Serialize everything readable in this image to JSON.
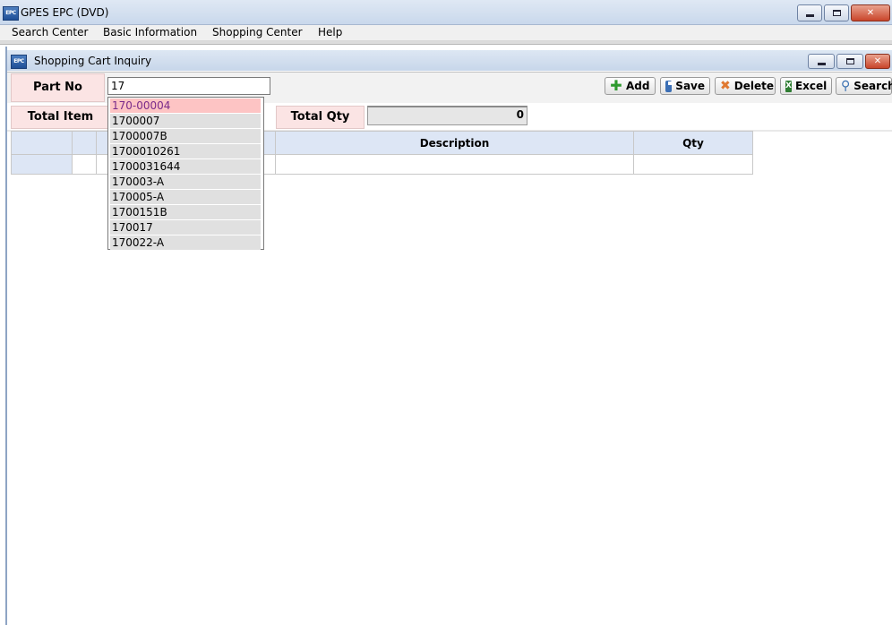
{
  "window": {
    "app_icon_text": "EPC",
    "title": "GPES EPC (DVD)"
  },
  "menu": [
    "Search Center",
    "Basic Information",
    "Shopping Center",
    "Help"
  ],
  "child_window": {
    "icon_text": "EPC",
    "title": "Shopping Cart Inquiry"
  },
  "form": {
    "part_no_label": "Part No",
    "part_no_value": "17",
    "total_item_label": "Total Item",
    "total_qty_label": "Total Qty",
    "total_qty_value": "0"
  },
  "toolbar": {
    "add": "Add",
    "save": "Save",
    "delete": "Delete",
    "excel": "Excel",
    "search": "Search"
  },
  "grid": {
    "columns": [
      "",
      "",
      "",
      "Description",
      "Qty"
    ]
  },
  "suggestions": {
    "selected_index": 0,
    "items": [
      "170-00004",
      "1700007",
      "1700007B",
      "1700010261",
      "1700031644",
      "170003-A",
      "170005-A",
      "1700151B",
      "170017",
      "170022-A"
    ]
  },
  "colors": {
    "label_bg": "#fbe4e4",
    "grid_header_bg": "#dde6f5",
    "selected_suggestion_bg": "#fdc4c4",
    "suggestion_bg": "#e0e0e0"
  },
  "icons": [
    "epc-app-icon",
    "minimize-icon",
    "maximize-icon",
    "close-icon",
    "add-icon",
    "save-icon",
    "delete-icon",
    "excel-icon",
    "search-icon"
  ]
}
